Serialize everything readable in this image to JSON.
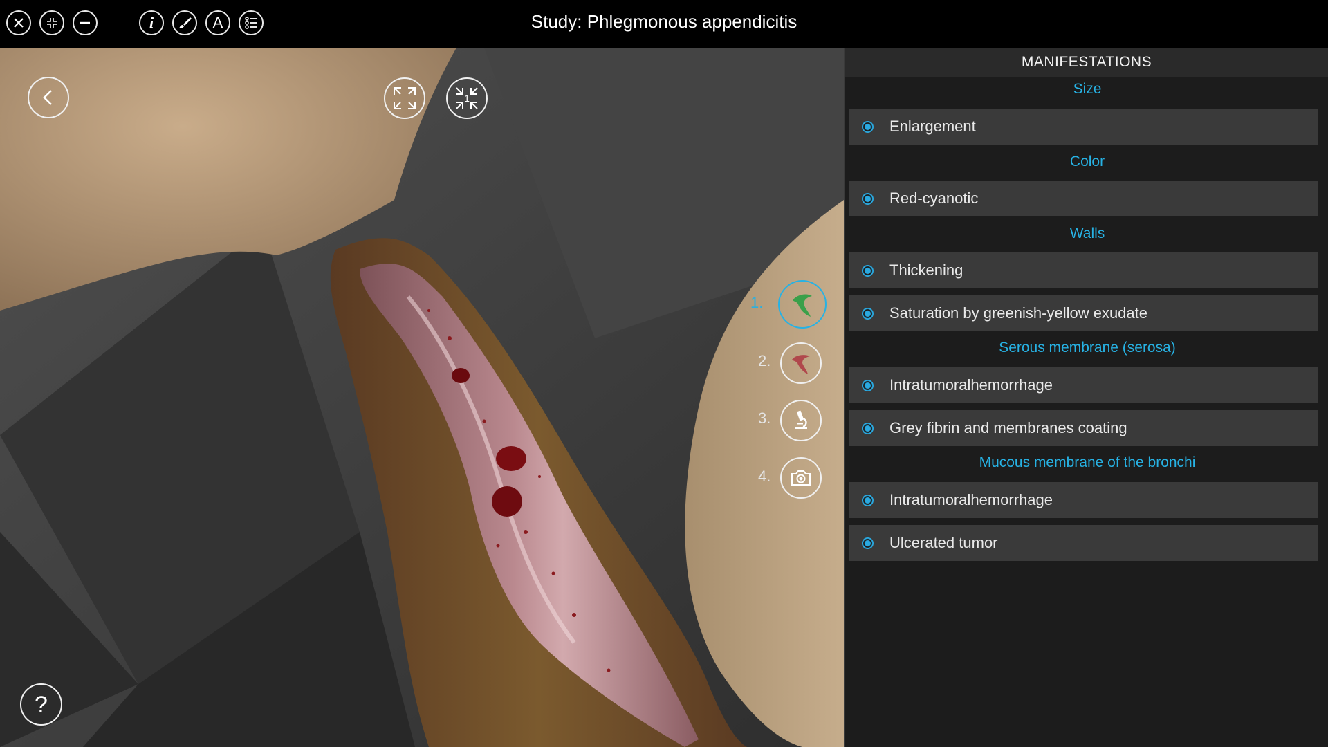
{
  "app": {
    "title": "Study: Phlegmonous appendicitis"
  },
  "toolbar": {
    "left_icons": [
      "close-icon",
      "compress-icon",
      "minimize-icon"
    ],
    "mid_icons": [
      "info-icon",
      "brush-icon",
      "text-annotation-icon",
      "list-icon"
    ]
  },
  "viewport": {
    "step_labels": [
      "1.",
      "2.",
      "3.",
      "4."
    ],
    "active_step": 1,
    "zoom_badge": "1"
  },
  "panel": {
    "header": "MANIFESTATIONS",
    "sections": [
      {
        "title": "Size",
        "items": [
          "Enlargement"
        ]
      },
      {
        "title": "Color",
        "items": [
          "Red-cyanotic"
        ]
      },
      {
        "title": "Walls",
        "items": [
          "Thickening",
          "Saturation by greenish-yellow exudate"
        ]
      },
      {
        "title": "Serous membrane (serosa)",
        "items": [
          "Intratumoralhemorrhage",
          "Grey fibrin and membranes coating"
        ]
      },
      {
        "title": "Mucous membrane of the bronchi",
        "items": [
          "Intratumoralhemorrhage",
          "Ulcerated tumor"
        ]
      }
    ]
  },
  "colors": {
    "accent": "#27b2e4",
    "panel_bg": "#1c1c1c",
    "row_bg": "#3a3a3a",
    "topbar_bg": "#000000"
  }
}
